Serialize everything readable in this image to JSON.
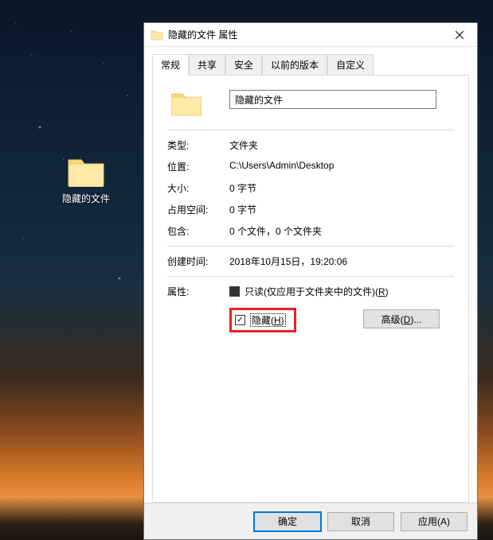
{
  "desktop": {
    "icon_label": "隐藏的文件"
  },
  "dialog": {
    "title": "隐藏的文件 属性",
    "tabs": {
      "general": "常规",
      "sharing": "共享",
      "security": "安全",
      "previous": "以前的版本",
      "custom": "自定义"
    },
    "name_value": "隐藏的文件",
    "rows": {
      "type_label": "类型:",
      "type_value": "文件夹",
      "location_label": "位置:",
      "location_value": "C:\\Users\\Admin\\Desktop",
      "size_label": "大小:",
      "size_value": "0 字节",
      "sizeondisk_label": "占用空间:",
      "sizeondisk_value": "0 字节",
      "contains_label": "包含:",
      "contains_value": "0 个文件，0 个文件夹",
      "created_label": "创建时间:",
      "created_value": "2018年10月15日，19:20:06",
      "attributes_label": "属性:"
    },
    "attrs": {
      "readonly_prefix": "只读(仅应用于文件夹中的文件)(",
      "readonly_accel": "R",
      "readonly_suffix": ")",
      "hidden_prefix": "隐藏(",
      "hidden_accel": "H",
      "hidden_suffix": ")",
      "advanced_prefix": "高级(",
      "advanced_accel": "D",
      "advanced_suffix": ")..."
    },
    "buttons": {
      "ok": "确定",
      "cancel": "取消",
      "apply": "应用(A)"
    }
  }
}
